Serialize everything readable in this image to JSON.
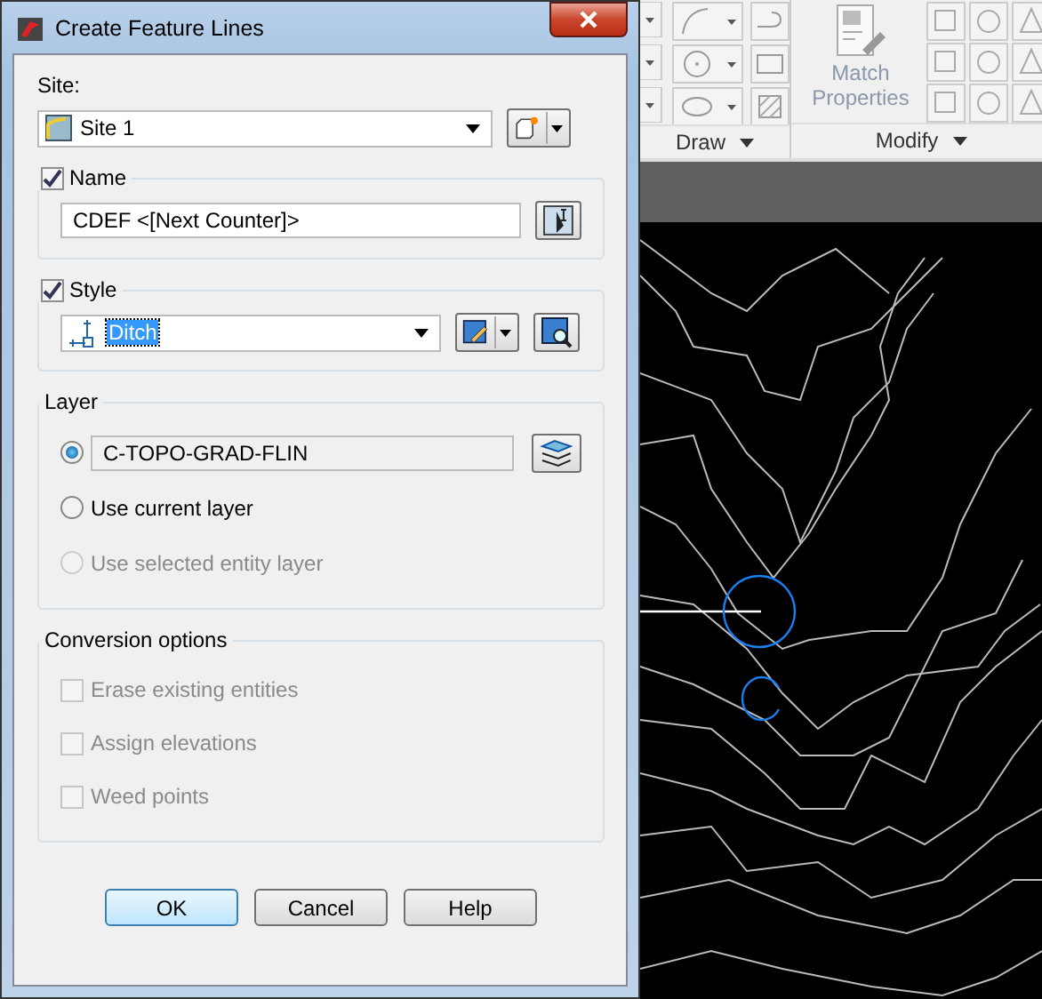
{
  "window": {
    "title": "Create Feature Lines"
  },
  "site": {
    "label": "Site:",
    "value": "Site 1"
  },
  "name": {
    "label": "Name",
    "checked": true,
    "value": "CDEF <[Next Counter]>"
  },
  "style": {
    "label": "Style",
    "checked": true,
    "value": "Ditch",
    "highlighted": true
  },
  "layer": {
    "title": "Layer",
    "options": [
      {
        "kind": "field",
        "value": "C-TOPO-GRAD-FLIN",
        "selected": true,
        "disabled": false
      },
      {
        "kind": "label",
        "label": "Use current layer",
        "selected": false,
        "disabled": false
      },
      {
        "kind": "label",
        "label": "Use selected entity layer",
        "selected": false,
        "disabled": true
      }
    ]
  },
  "conversion": {
    "title": "Conversion options",
    "options": [
      {
        "label": "Erase existing entities",
        "checked": false,
        "disabled": true
      },
      {
        "label": "Assign elevations",
        "checked": false,
        "disabled": true
      },
      {
        "label": "Weed points",
        "checked": false,
        "disabled": true
      }
    ]
  },
  "buttons": [
    {
      "label": "OK",
      "default": true
    },
    {
      "label": "Cancel",
      "default": false
    },
    {
      "label": "Help",
      "default": false
    }
  ],
  "ribbon": {
    "match_properties": "Match Properties",
    "groups": [
      {
        "label": "Draw"
      },
      {
        "label": "Modify"
      }
    ]
  }
}
